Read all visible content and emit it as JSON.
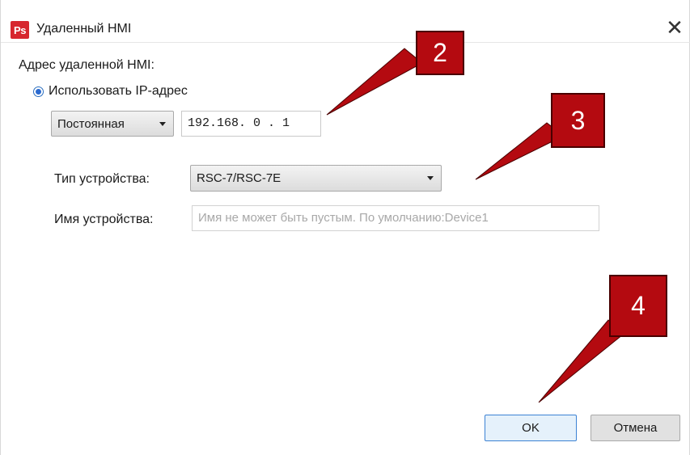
{
  "window": {
    "app_icon_text": "Ps",
    "title": "Удаленный HMI",
    "close_glyph": "✕"
  },
  "address": {
    "section_label": "Адрес удаленной HMI:",
    "radio_label": "Использовать IP-адрес",
    "radio_selected": true,
    "mode_select_value": "Постоянная",
    "ip_value": "192.168. 0 . 1"
  },
  "device": {
    "type_label": "Тип устройства:",
    "type_value": "RSC-7/RSC-7E",
    "name_label": "Имя устройства:",
    "name_placeholder": "Имя не может быть пустым. По умолчанию:Device1"
  },
  "buttons": {
    "ok_label": "OK",
    "cancel_label": "Отмена"
  },
  "annotations": {
    "callout_2": "2",
    "callout_3": "3",
    "callout_4": "4",
    "color": "#b40a10"
  }
}
